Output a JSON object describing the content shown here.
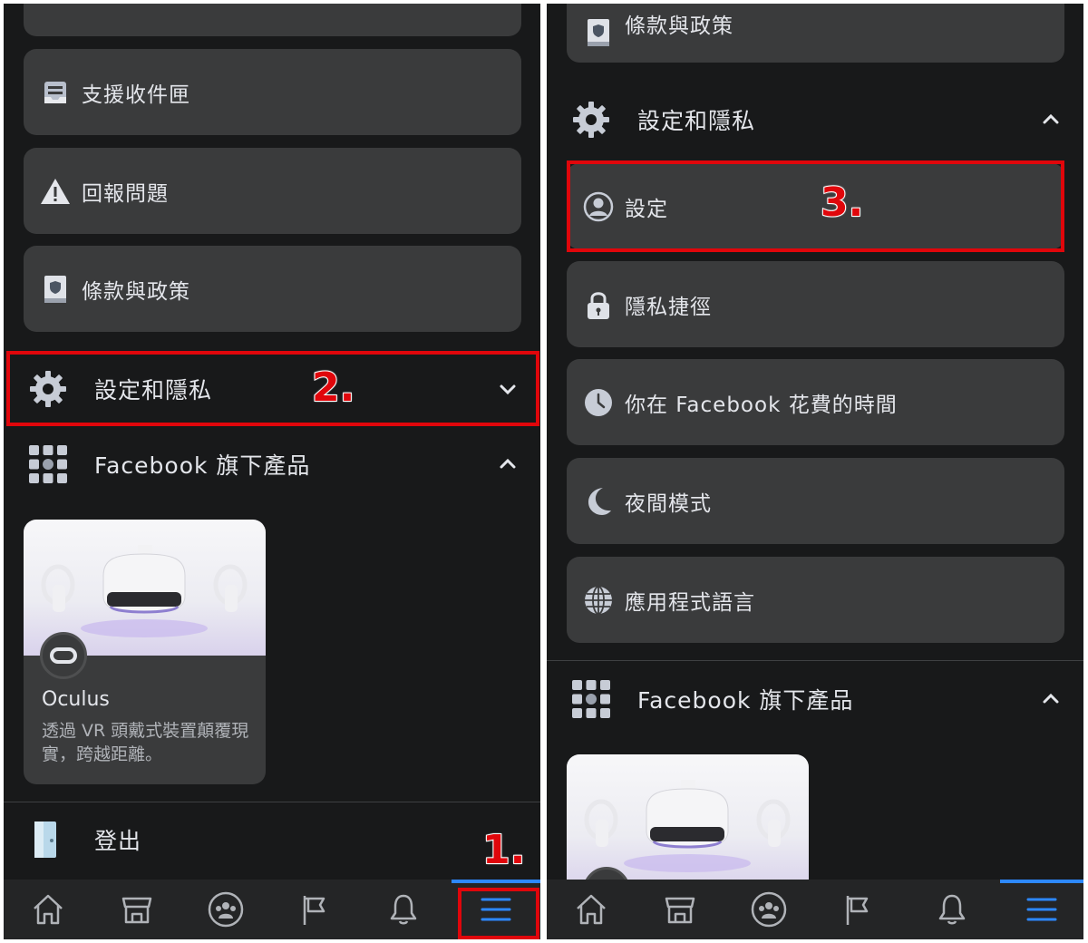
{
  "left": {
    "menu_items": [
      {
        "label": "支援收件匣",
        "icon": "inbox-icon"
      },
      {
        "label": "回報問題",
        "icon": "warning-icon"
      },
      {
        "label": "條款與政策",
        "icon": "policy-book-icon"
      }
    ],
    "settings_section": {
      "label": "設定和隱私",
      "icon": "gear-icon",
      "chevron": "chevron-down-icon"
    },
    "products_section": {
      "label": "Facebook 旗下產品",
      "icon": "grid-icon",
      "chevron": "chevron-up-icon"
    },
    "product_card": {
      "name": "Oculus",
      "description": "透過 VR 頭戴式裝置顛覆現實，跨越距離。"
    },
    "logout": {
      "label": "登出",
      "icon": "door-icon"
    },
    "steps": {
      "step1": "1.",
      "step2": "2."
    }
  },
  "right": {
    "top_item": {
      "label": "條款與政策",
      "icon": "policy-book-icon"
    },
    "settings_section": {
      "label": "設定和隱私",
      "icon": "gear-icon",
      "chevron": "chevron-up-icon"
    },
    "settings_items": [
      {
        "label": "設定",
        "icon": "user-circle-icon"
      },
      {
        "label": "隱私捷徑",
        "icon": "lock-icon"
      },
      {
        "label": "你在 Facebook 花費的時間",
        "icon": "clock-icon"
      },
      {
        "label": "夜間模式",
        "icon": "moon-icon"
      },
      {
        "label": "應用程式語言",
        "icon": "globe-icon"
      }
    ],
    "products_section": {
      "label": "Facebook 旗下產品",
      "icon": "grid-icon",
      "chevron": "chevron-up-icon"
    },
    "steps": {
      "step3": "3."
    }
  },
  "tabs": [
    {
      "name": "home",
      "icon": "home-icon"
    },
    {
      "name": "marketplace",
      "icon": "marketplace-icon"
    },
    {
      "name": "groups",
      "icon": "groups-icon"
    },
    {
      "name": "pages",
      "icon": "flag-icon"
    },
    {
      "name": "notifications",
      "icon": "bell-icon"
    },
    {
      "name": "menu",
      "icon": "menu-icon",
      "active": true
    }
  ],
  "colors": {
    "background": "#18191a",
    "card": "#3a3b3c",
    "text": "#e4e6eb",
    "accent": "#2d88ff",
    "annotation": "#e0060b"
  }
}
